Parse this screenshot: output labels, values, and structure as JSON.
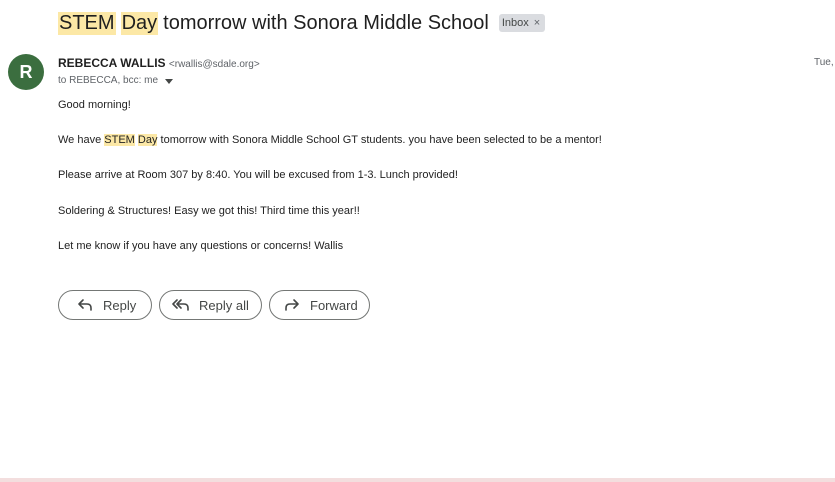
{
  "subject": {
    "hl1": "STEM",
    "hl2": "Day",
    "rest": "tomorrow with Sonora Middle School",
    "label": "Inbox",
    "label_remove": "×"
  },
  "sender": {
    "avatar_letter": "R",
    "name": "REBECCA WALLIS",
    "email": "<rwallis@sdale.org>",
    "date": "Tue,",
    "recipients": "to REBECCA, bcc: me"
  },
  "body": {
    "line1": "Good morning!",
    "line2_pre": "We have ",
    "line2_hl1": "STEM",
    "line2_hl2": "Day",
    "line2_post": " tomorrow with Sonora Middle School GT students. you have been selected to be a mentor!",
    "line3": "Please arrive at Room 307 by 8:40. You will be excused from 1-3. Lunch provided!",
    "line4": "Soldering & Structures! Easy we got this! Third time this year!!",
    "line5": "Let me know if you have any questions or concerns! Wallis"
  },
  "actions": {
    "reply": "Reply",
    "reply_all": "Reply all",
    "forward": "Forward"
  },
  "icons": [
    "reply-icon",
    "reply-all-icon",
    "forward-icon",
    "close-icon",
    "caret-down-icon"
  ],
  "colors": {
    "highlight": "#fce8a6",
    "avatar": "#3b6e3f",
    "chip": "#dadce0"
  }
}
